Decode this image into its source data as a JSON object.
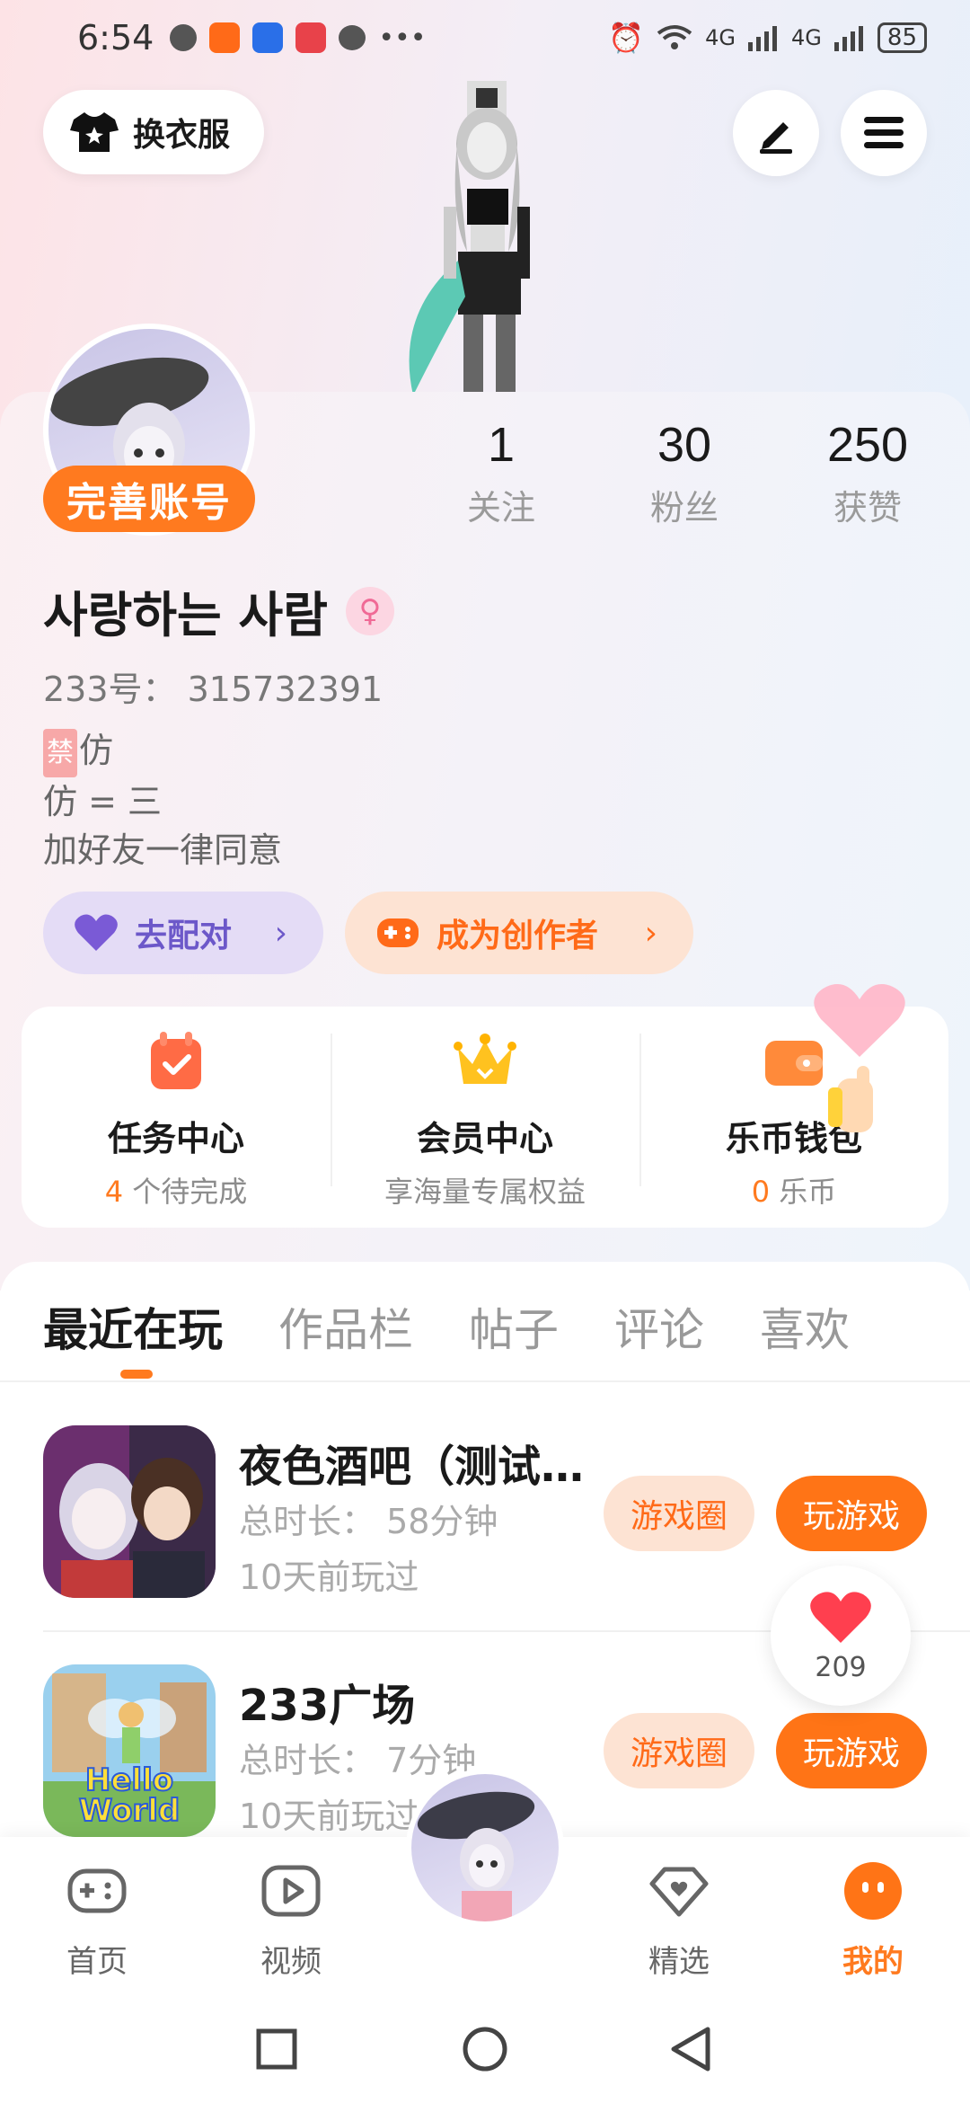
{
  "status_bar": {
    "time": "6:54",
    "signal_1": "4G",
    "signal_2": "4G",
    "battery": "85"
  },
  "header": {
    "outfit_label": "换衣服"
  },
  "stats": [
    {
      "num": "1",
      "label": "关注"
    },
    {
      "num": "30",
      "label": "粉丝"
    },
    {
      "num": "250",
      "label": "获赞"
    }
  ],
  "profile": {
    "complete_badge": "完善账号",
    "nickname": "사랑하는 사람",
    "uid": "233号：  315732391",
    "bio_forbid": "禁",
    "bio_line1": "仿",
    "bio_line2": "仿 = 三",
    "bio_line3": "加好友一律同意"
  },
  "actions": {
    "match_label": "去配对",
    "creator_label": "成为创作者",
    "chevron": "›"
  },
  "centers": [
    {
      "title": "任务中心",
      "highlight": "4",
      "sub": " 个待完成"
    },
    {
      "title": "会员中心",
      "highlight": "",
      "sub": "享海量专属权益"
    },
    {
      "title": "乐币钱包",
      "highlight": "0",
      "sub": " 乐币"
    }
  ],
  "tabs": [
    "最近在玩",
    "作品栏",
    "帖子",
    "评论",
    "喜欢"
  ],
  "games": [
    {
      "title": "夜色酒吧（测试服）",
      "duration": "总时长：  58分钟",
      "last_played": "10天前玩过",
      "circle_btn": "游戏圈",
      "play_btn": "玩游戏"
    },
    {
      "title": "233广场",
      "duration": "总时长：  7分钟",
      "last_played": "10天前玩过",
      "circle_btn": "游戏圈",
      "play_btn": "玩游戏",
      "thumb_text_1": "Hello",
      "thumb_text_2": "World"
    }
  ],
  "like_bubble": {
    "count": "209"
  },
  "bottom_nav": [
    {
      "label": "首页"
    },
    {
      "label": "视频"
    },
    {
      "label": "精选"
    },
    {
      "label": "我的"
    }
  ],
  "colors": {
    "accent": "#ff7a1f",
    "purple": "#6c58c9",
    "pink": "#f06a96"
  }
}
